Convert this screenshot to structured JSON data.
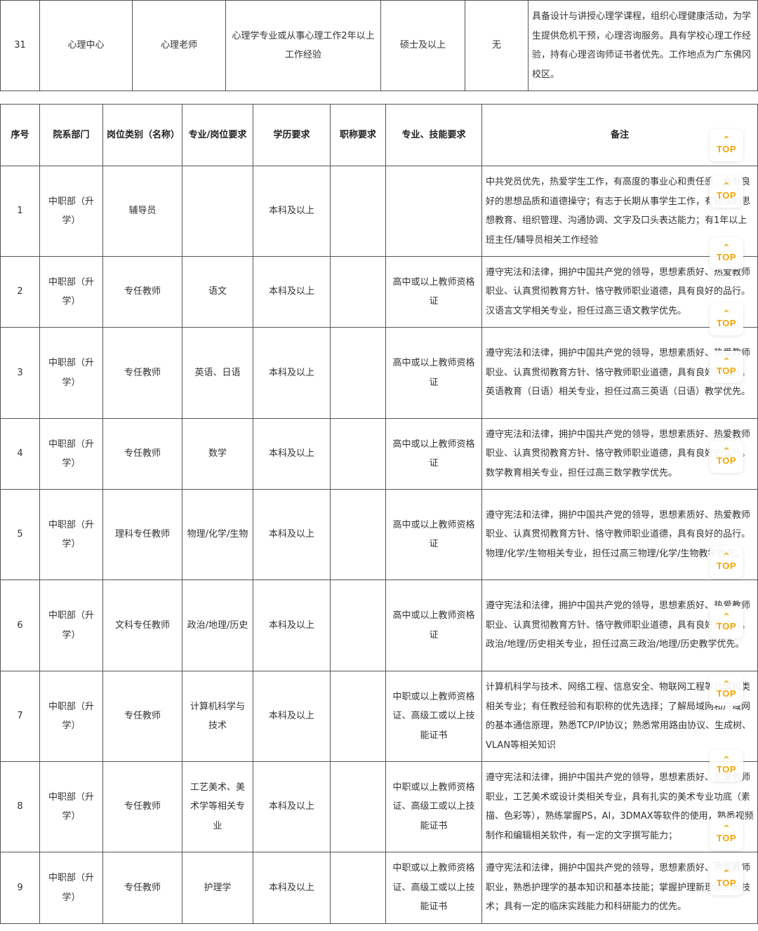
{
  "top_row": {
    "no": "31",
    "department": "心理中心",
    "category": "心理老师",
    "major": "心理学专业或从事心理工作2年以上工作经验",
    "education": "硕士及以上",
    "title_req": "无",
    "note": "具备设计与讲授心理学课程，组织心理健康活动，为学生提供危机干预，心理咨询服务。具有学校心理工作经验，持有心理咨询师证书者优先。工作地点为广东佛冈校区。"
  },
  "headers": {
    "no": "序号",
    "department": "院系部门",
    "category": "岗位类别（名称）",
    "major": "专业/岗位要求",
    "education": "学历要求",
    "title_req": "职称要求",
    "skill": "专业、技能要求",
    "note": "备注"
  },
  "rows": [
    {
      "no": "1",
      "department": "中职部（升学）",
      "category": "辅导员",
      "major": "",
      "education": "本科及以上",
      "title_req": "",
      "skill": "",
      "note": "中共党员优先，热爱学生工作，有高度的事业心和责任感，具有良好的思想品质和道德操守；有志于长期从事学生工作，有较强的思想教育、组织管理、沟通协调、文字及口头表达能力；有1年以上班主任/辅导员相关工作经验"
    },
    {
      "no": "2",
      "department": "中职部（升学）",
      "category": "专任教师",
      "major": "语文",
      "education": "本科及以上",
      "title_req": "",
      "skill": "高中或以上教师资格证",
      "note": "遵守宪法和法律，拥护中国共产党的领导，思想素质好、热爱教师职业、认真贯彻教育方针、恪守教师职业道德，具有良好的品行。汉语言文学相关专业，担任过高三语文教学优先。"
    },
    {
      "no": "3",
      "department": "中职部（升学）",
      "category": "专任教师",
      "major": "英语、日语",
      "education": "本科及以上",
      "title_req": "",
      "skill": "高中或以上教师资格证",
      "note": "遵守宪法和法律，拥护中国共产党的领导，思想素质好、热爱教师职业、认真贯彻教育方针、恪守教师职业道德，具有良好的品行。英语教育（日语）相关专业，担任过高三英语（日语）教学优先。"
    },
    {
      "no": "4",
      "department": "中职部（升学）",
      "category": "专任教师",
      "major": "数学",
      "education": "本科及以上",
      "title_req": "",
      "skill": "高中或以上教师资格证",
      "note": "遵守宪法和法律，拥护中国共产党的领导，思想素质好、热爱教师职业、认真贯彻教育方针、恪守教师职业道德，具有良好的品行。数学教育相关专业，担任过高三数学教学优先。"
    },
    {
      "no": "5",
      "department": "中职部（升学）",
      "category": "理科专任教师",
      "major": "物理/化学/生物",
      "education": "本科及以上",
      "title_req": "",
      "skill": "高中或以上教师资格证",
      "note": "遵守宪法和法律，拥护中国共产党的领导，思想素质好、热爱教师职业、认真贯彻教育方针、恪守教师职业道德，具有良好的品行。物理/化学/生物相关专业，担任过高三物理/化学/生物教学优先。"
    },
    {
      "no": "6",
      "department": "中职部（升学）",
      "category": "文科专任教师",
      "major": "政治/地理/历史",
      "education": "本科及以上",
      "title_req": "",
      "skill": "高中或以上教师资格证",
      "note": "遵守宪法和法律，拥护中国共产党的领导，思想素质好、热爱教师职业、认真贯彻教育方针、恪守教师职业道德，具有良好的品行。政治/地理/历史相关专业，担任过高三政治/地理/历史教学优先。"
    },
    {
      "no": "7",
      "department": "中职部（升学）",
      "category": "专任教师",
      "major": "计算机科学与技术",
      "education": "本科及以上",
      "title_req": "",
      "skill": "中职或以上教师资格证、高级工或以上技能证书",
      "note": "计算机科学与技术、网络工程、信息安全、物联网工程等计算机类相关专业；有任教经验和有职称的优先选择；了解局域网和广域网的基本通信原理，熟悉TCP/IP协议；熟悉常用路由协议、生成树、VLAN等相关知识"
    },
    {
      "no": "8",
      "department": "中职部（升学）",
      "category": "专任教师",
      "major": "工艺美术、美术学等相关专业",
      "education": "本科及以上",
      "title_req": "",
      "skill": "中职或以上教师资格证、高级工或以上技能证书",
      "note": "遵守宪法和法律，拥护中国共产党的领导，思想素质好、热爱教师职业，工艺美术或设计类相关专业，具有扎实的美术专业功底（素描、色彩等），熟练掌握PS，AI，3DMAX等软件的使用，熟悉视频制作和编辑相关软件，有一定的文字撰写能力；"
    },
    {
      "no": "9",
      "department": "中职部（升学）",
      "category": "专任教师",
      "major": "护理学",
      "education": "本科及以上",
      "title_req": "",
      "skill": "中职或以上教师资格证、高级工或以上技能证书",
      "note": "遵守宪法和法律，拥护中国共产党的领导，思想素质好、热爱教师职业，熟悉护理学的基本知识和基本技能；掌握护理新理论、新技术；具有一定的临床实践能力和科研能力的优先。"
    }
  ],
  "top_button": {
    "label": "TOP",
    "icon": "chevron-up-icon",
    "color": "#f2a500"
  }
}
